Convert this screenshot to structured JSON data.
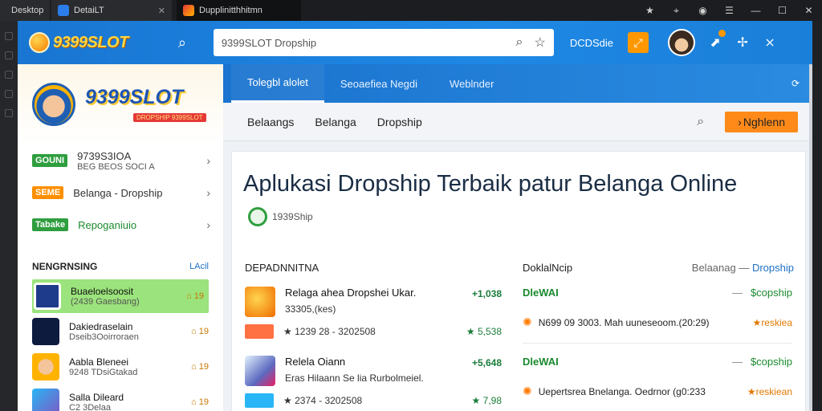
{
  "browser": {
    "tabs": [
      {
        "label": "Desktop"
      },
      {
        "label": "DetaiLT"
      },
      {
        "label": "Dupplinitthhitmn"
      }
    ],
    "controls": [
      "star-icon",
      "location-icon",
      "profile-icon",
      "menu-icon",
      "minimize-icon",
      "maximize-icon",
      "close-icon"
    ]
  },
  "app": {
    "logo_text": "9399SLOT",
    "address_value": "9399SLOT Dropship",
    "user_label": "DCDSdie",
    "accent": "#1e88e5",
    "orange": "#ff8a1a"
  },
  "sidebar": {
    "brand": "9399SLOT",
    "brand_sub": "DROPSHIP 9399SLOT",
    "menu": [
      {
        "badge": "GOUNI",
        "label": "9739S3IOA",
        "sub": "BEG BEOS SOCI A"
      },
      {
        "badge": "SEME",
        "label": "Belanga - Dropship",
        "sub": ""
      },
      {
        "badge": "Tabake",
        "label": "Repoganiuio",
        "sub": ""
      }
    ],
    "section_title": "NENGRNSING",
    "section_link": "LAcil",
    "games": [
      {
        "name": "Buaeloelsoosit",
        "sub": "(2439 Gaesbang)",
        "meta": "19"
      },
      {
        "name": "Dakiedraselain",
        "sub": "Dseib3Ooirroraen",
        "meta": "19"
      },
      {
        "name": "Aabla Bleneei",
        "sub": "9248 TDsiGtakad",
        "meta": "19"
      },
      {
        "name": "Salla Dileard",
        "sub": "C2 3Delaa",
        "meta": "19"
      }
    ]
  },
  "content": {
    "tabs": [
      "Tolegbl alolet",
      "Seoaefiea Negdi",
      "Weblnder"
    ],
    "subnav": [
      "Belaangs",
      "Belanga",
      "Dropship"
    ],
    "cta": "Nghlenn",
    "headline": "Aplukasi Dropship Terbaik patur Belanga Online",
    "headline_chip": "1939Ship",
    "left_col_title": "DEPADNNITNA",
    "right_col_title": "DoklalNcip",
    "right_col_link_a": "Belaanag —",
    "right_col_link_b": "Dropship",
    "products": [
      {
        "name": "Relaga ahea Dropshei Ukar.",
        "price": "33305,(kes)",
        "delta": "+1,038",
        "row2": "★ 1239 28 - 3202508",
        "delta2": "★ 5,538"
      },
      {
        "name": "Relela Oiann",
        "price": "Eras Hilaann Se lia Rurbolmeiel.",
        "delta": "+5,648",
        "row2": "★ 2374 - 3202508",
        "delta2": "★ 7,98"
      }
    ],
    "right_rows": [
      {
        "label": "DleWAI",
        "value": "$copship",
        "line": "N699 09 3003. Mah uuneseoom.(20:29)",
        "rating": "reskiea"
      },
      {
        "label": "DleWAI",
        "value": "$copship",
        "line": "Uepertsrea Bnelanga. Oedrnor (g0:233",
        "rating": "reskiean"
      }
    ]
  }
}
